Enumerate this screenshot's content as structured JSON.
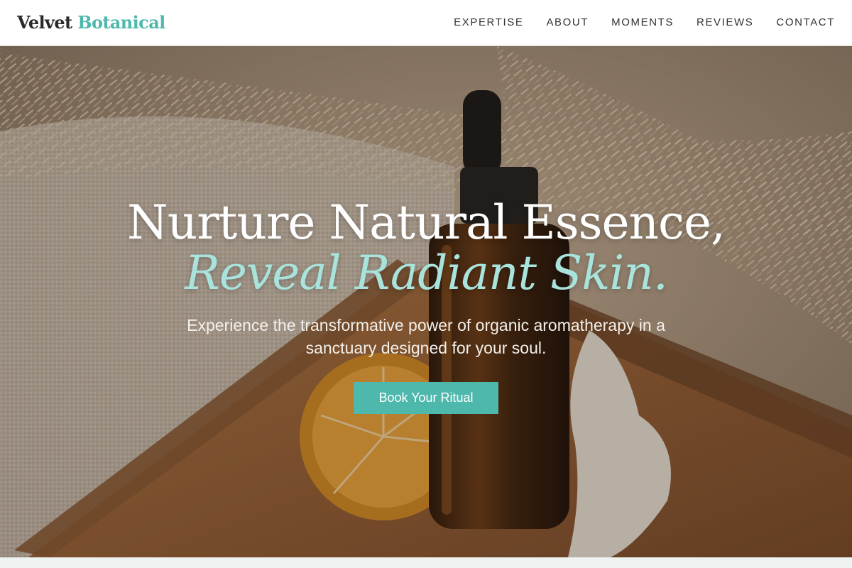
{
  "brand": {
    "word1": "Velvet",
    "word2": "Botanical"
  },
  "nav": {
    "items": [
      "EXPERTISE",
      "ABOUT",
      "MOMENTS",
      "REVIEWS",
      "CONTACT"
    ]
  },
  "hero": {
    "headline_line1": "Nurture Natural Essence,",
    "headline_line2": "Reveal Radiant Skin.",
    "subtitle": "Experience the transformative power of organic aromatherapy in a sanctuary designed for your soul.",
    "cta_label": "Book Your Ritual"
  },
  "colors": {
    "accent": "#4eb8ad",
    "accent_light": "#a8e3dc",
    "header_bg": "#ffffff",
    "text_dark": "#2a2a2a"
  }
}
